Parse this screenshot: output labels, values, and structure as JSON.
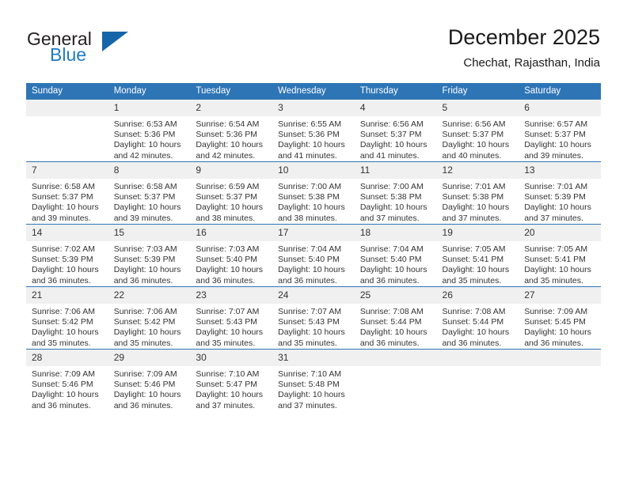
{
  "brand": {
    "name_top": "General",
    "name_bottom": "Blue",
    "triangle_icon": "blue-triangle-logo",
    "color_dark": "#231f20",
    "color_blue": "#1f7ac4",
    "color_triangle": "#1565a9"
  },
  "header": {
    "title": "December 2025",
    "subtitle": "Chechat, Rajasthan, India"
  },
  "colors": {
    "header_row_bg": "#2e75b6",
    "daynum_bg": "#f0f0f0",
    "cell_border": "#2e75b6",
    "text": "#333333"
  },
  "weekday_headers": [
    "Sunday",
    "Monday",
    "Tuesday",
    "Wednesday",
    "Thursday",
    "Friday",
    "Saturday"
  ],
  "labels": {
    "sunrise": "Sunrise:",
    "sunset": "Sunset:",
    "daylight": "Daylight:"
  },
  "weeks": [
    [
      {
        "day": "",
        "sunrise": "",
        "sunset": "",
        "daylight_1": "",
        "daylight_2": ""
      },
      {
        "day": "1",
        "sunrise": "Sunrise: 6:53 AM",
        "sunset": "Sunset: 5:36 PM",
        "daylight_1": "Daylight: 10 hours",
        "daylight_2": "and 42 minutes."
      },
      {
        "day": "2",
        "sunrise": "Sunrise: 6:54 AM",
        "sunset": "Sunset: 5:36 PM",
        "daylight_1": "Daylight: 10 hours",
        "daylight_2": "and 42 minutes."
      },
      {
        "day": "3",
        "sunrise": "Sunrise: 6:55 AM",
        "sunset": "Sunset: 5:36 PM",
        "daylight_1": "Daylight: 10 hours",
        "daylight_2": "and 41 minutes."
      },
      {
        "day": "4",
        "sunrise": "Sunrise: 6:56 AM",
        "sunset": "Sunset: 5:37 PM",
        "daylight_1": "Daylight: 10 hours",
        "daylight_2": "and 41 minutes."
      },
      {
        "day": "5",
        "sunrise": "Sunrise: 6:56 AM",
        "sunset": "Sunset: 5:37 PM",
        "daylight_1": "Daylight: 10 hours",
        "daylight_2": "and 40 minutes."
      },
      {
        "day": "6",
        "sunrise": "Sunrise: 6:57 AM",
        "sunset": "Sunset: 5:37 PM",
        "daylight_1": "Daylight: 10 hours",
        "daylight_2": "and 39 minutes."
      }
    ],
    [
      {
        "day": "7",
        "sunrise": "Sunrise: 6:58 AM",
        "sunset": "Sunset: 5:37 PM",
        "daylight_1": "Daylight: 10 hours",
        "daylight_2": "and 39 minutes."
      },
      {
        "day": "8",
        "sunrise": "Sunrise: 6:58 AM",
        "sunset": "Sunset: 5:37 PM",
        "daylight_1": "Daylight: 10 hours",
        "daylight_2": "and 39 minutes."
      },
      {
        "day": "9",
        "sunrise": "Sunrise: 6:59 AM",
        "sunset": "Sunset: 5:37 PM",
        "daylight_1": "Daylight: 10 hours",
        "daylight_2": "and 38 minutes."
      },
      {
        "day": "10",
        "sunrise": "Sunrise: 7:00 AM",
        "sunset": "Sunset: 5:38 PM",
        "daylight_1": "Daylight: 10 hours",
        "daylight_2": "and 38 minutes."
      },
      {
        "day": "11",
        "sunrise": "Sunrise: 7:00 AM",
        "sunset": "Sunset: 5:38 PM",
        "daylight_1": "Daylight: 10 hours",
        "daylight_2": "and 37 minutes."
      },
      {
        "day": "12",
        "sunrise": "Sunrise: 7:01 AM",
        "sunset": "Sunset: 5:38 PM",
        "daylight_1": "Daylight: 10 hours",
        "daylight_2": "and 37 minutes."
      },
      {
        "day": "13",
        "sunrise": "Sunrise: 7:01 AM",
        "sunset": "Sunset: 5:39 PM",
        "daylight_1": "Daylight: 10 hours",
        "daylight_2": "and 37 minutes."
      }
    ],
    [
      {
        "day": "14",
        "sunrise": "Sunrise: 7:02 AM",
        "sunset": "Sunset: 5:39 PM",
        "daylight_1": "Daylight: 10 hours",
        "daylight_2": "and 36 minutes."
      },
      {
        "day": "15",
        "sunrise": "Sunrise: 7:03 AM",
        "sunset": "Sunset: 5:39 PM",
        "daylight_1": "Daylight: 10 hours",
        "daylight_2": "and 36 minutes."
      },
      {
        "day": "16",
        "sunrise": "Sunrise: 7:03 AM",
        "sunset": "Sunset: 5:40 PM",
        "daylight_1": "Daylight: 10 hours",
        "daylight_2": "and 36 minutes."
      },
      {
        "day": "17",
        "sunrise": "Sunrise: 7:04 AM",
        "sunset": "Sunset: 5:40 PM",
        "daylight_1": "Daylight: 10 hours",
        "daylight_2": "and 36 minutes."
      },
      {
        "day": "18",
        "sunrise": "Sunrise: 7:04 AM",
        "sunset": "Sunset: 5:40 PM",
        "daylight_1": "Daylight: 10 hours",
        "daylight_2": "and 36 minutes."
      },
      {
        "day": "19",
        "sunrise": "Sunrise: 7:05 AM",
        "sunset": "Sunset: 5:41 PM",
        "daylight_1": "Daylight: 10 hours",
        "daylight_2": "and 35 minutes."
      },
      {
        "day": "20",
        "sunrise": "Sunrise: 7:05 AM",
        "sunset": "Sunset: 5:41 PM",
        "daylight_1": "Daylight: 10 hours",
        "daylight_2": "and 35 minutes."
      }
    ],
    [
      {
        "day": "21",
        "sunrise": "Sunrise: 7:06 AM",
        "sunset": "Sunset: 5:42 PM",
        "daylight_1": "Daylight: 10 hours",
        "daylight_2": "and 35 minutes."
      },
      {
        "day": "22",
        "sunrise": "Sunrise: 7:06 AM",
        "sunset": "Sunset: 5:42 PM",
        "daylight_1": "Daylight: 10 hours",
        "daylight_2": "and 35 minutes."
      },
      {
        "day": "23",
        "sunrise": "Sunrise: 7:07 AM",
        "sunset": "Sunset: 5:43 PM",
        "daylight_1": "Daylight: 10 hours",
        "daylight_2": "and 35 minutes."
      },
      {
        "day": "24",
        "sunrise": "Sunrise: 7:07 AM",
        "sunset": "Sunset: 5:43 PM",
        "daylight_1": "Daylight: 10 hours",
        "daylight_2": "and 35 minutes."
      },
      {
        "day": "25",
        "sunrise": "Sunrise: 7:08 AM",
        "sunset": "Sunset: 5:44 PM",
        "daylight_1": "Daylight: 10 hours",
        "daylight_2": "and 36 minutes."
      },
      {
        "day": "26",
        "sunrise": "Sunrise: 7:08 AM",
        "sunset": "Sunset: 5:44 PM",
        "daylight_1": "Daylight: 10 hours",
        "daylight_2": "and 36 minutes."
      },
      {
        "day": "27",
        "sunrise": "Sunrise: 7:09 AM",
        "sunset": "Sunset: 5:45 PM",
        "daylight_1": "Daylight: 10 hours",
        "daylight_2": "and 36 minutes."
      }
    ],
    [
      {
        "day": "28",
        "sunrise": "Sunrise: 7:09 AM",
        "sunset": "Sunset: 5:46 PM",
        "daylight_1": "Daylight: 10 hours",
        "daylight_2": "and 36 minutes."
      },
      {
        "day": "29",
        "sunrise": "Sunrise: 7:09 AM",
        "sunset": "Sunset: 5:46 PM",
        "daylight_1": "Daylight: 10 hours",
        "daylight_2": "and 36 minutes."
      },
      {
        "day": "30",
        "sunrise": "Sunrise: 7:10 AM",
        "sunset": "Sunset: 5:47 PM",
        "daylight_1": "Daylight: 10 hours",
        "daylight_2": "and 37 minutes."
      },
      {
        "day": "31",
        "sunrise": "Sunrise: 7:10 AM",
        "sunset": "Sunset: 5:48 PM",
        "daylight_1": "Daylight: 10 hours",
        "daylight_2": "and 37 minutes."
      },
      {
        "day": "",
        "sunrise": "",
        "sunset": "",
        "daylight_1": "",
        "daylight_2": ""
      },
      {
        "day": "",
        "sunrise": "",
        "sunset": "",
        "daylight_1": "",
        "daylight_2": ""
      },
      {
        "day": "",
        "sunrise": "",
        "sunset": "",
        "daylight_1": "",
        "daylight_2": ""
      }
    ]
  ]
}
